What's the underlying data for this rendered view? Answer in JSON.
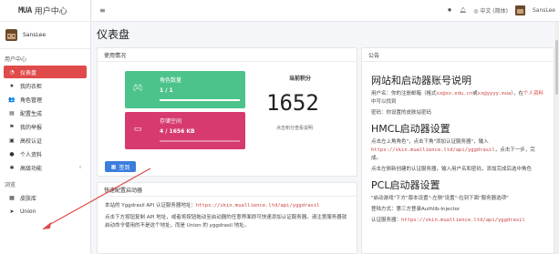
{
  "brand": {
    "logo": "MUA",
    "title": "用户中心"
  },
  "user": {
    "name": "SansLee"
  },
  "sidebar": {
    "header_user": "用户中心",
    "items": [
      {
        "label": "仪表盘",
        "icon": "dashboard-icon",
        "active": true
      },
      {
        "label": "我的衣柜",
        "icon": "star-icon"
      },
      {
        "label": "角色管理",
        "icon": "users-icon"
      },
      {
        "label": "配置生成",
        "icon": "file-icon"
      },
      {
        "label": "我的举报",
        "icon": "flag-icon"
      },
      {
        "label": "高校认证",
        "icon": "id-card-icon"
      },
      {
        "label": "个人资料",
        "icon": "user-icon"
      },
      {
        "label": "高级功能",
        "icon": "tools-icon"
      }
    ],
    "header_browse": "浏览",
    "browse_items": [
      {
        "label": "皮肤库",
        "icon": "store-icon"
      },
      {
        "label": "Union",
        "icon": "send-icon"
      }
    ]
  },
  "topbar": {
    "language": "中文 (简体)",
    "username": "SansLee"
  },
  "page": {
    "title": "仪表盘"
  },
  "usage": {
    "header": "使用情况",
    "roles": {
      "label": "角色数量",
      "value": "1 / 1",
      "fill": 1.0
    },
    "storage": {
      "label": "存储空间",
      "value": "4 / 1656 KB",
      "fill": 0.0
    },
    "score": {
      "title": "当前积分",
      "value": "1652",
      "note": "点击积分查看说明"
    },
    "checkin": "签到"
  },
  "notice": {
    "header": "公告",
    "h1": "网站和启动器账号说明",
    "p1": "用户名：你的注册邮箱（格式",
    "p1_code": "xx@xx.edu.cn",
    "p1_mid": "或",
    "p1_code2": "xx@yyyy.mua",
    "p1_end": "），在",
    "p1_link": "个人资料",
    "p1_tail": "中可以找到",
    "p2": "密码：你设置的皮肤站密码",
    "h2": "HMCL启动器设置",
    "p3": "点击左上角角色\"，点击下角\"添加认证服务器\"，输入",
    "p3_code": "https://skin.muallience.ltd/api/yggdrasil",
    "p3_end": "，点击下一步，完成。",
    "p4": "点击左侧新创建的认证服务器，输入用户名和密码，添加完成后选中角色",
    "h3": "PCL启动器设置",
    "p5": "\"启动游戏\"下方\"版本设置\"-左侧\"设置\"-拉到下面\"服务器选项\"",
    "p6": "登陆方式：第三方登录Authlib-Injector",
    "p7": "认证服务器：",
    "p7_code": "https://skin.muallience.ltd/api/yggdrasil"
  },
  "quick": {
    "header": "快速配置启动器",
    "p1": "本站的 Yggdrasil API 认证服务器地址：",
    "p1_code": "https://skin.muallience.ltd/api/yggdrasil",
    "p2": "点击下方按钮复制 API 地址，或者将按钮拖动至启动器的任意界面即可快速添加认证服务器。请注意服务器就启动命令使用的不是这个地址，而是 Union 的 yggdrasil 地址。"
  },
  "colors": {
    "accent": "#e04a4a",
    "green": "#4cc38a",
    "pink": "#d63a6e",
    "primary": "#3b7ddd"
  }
}
